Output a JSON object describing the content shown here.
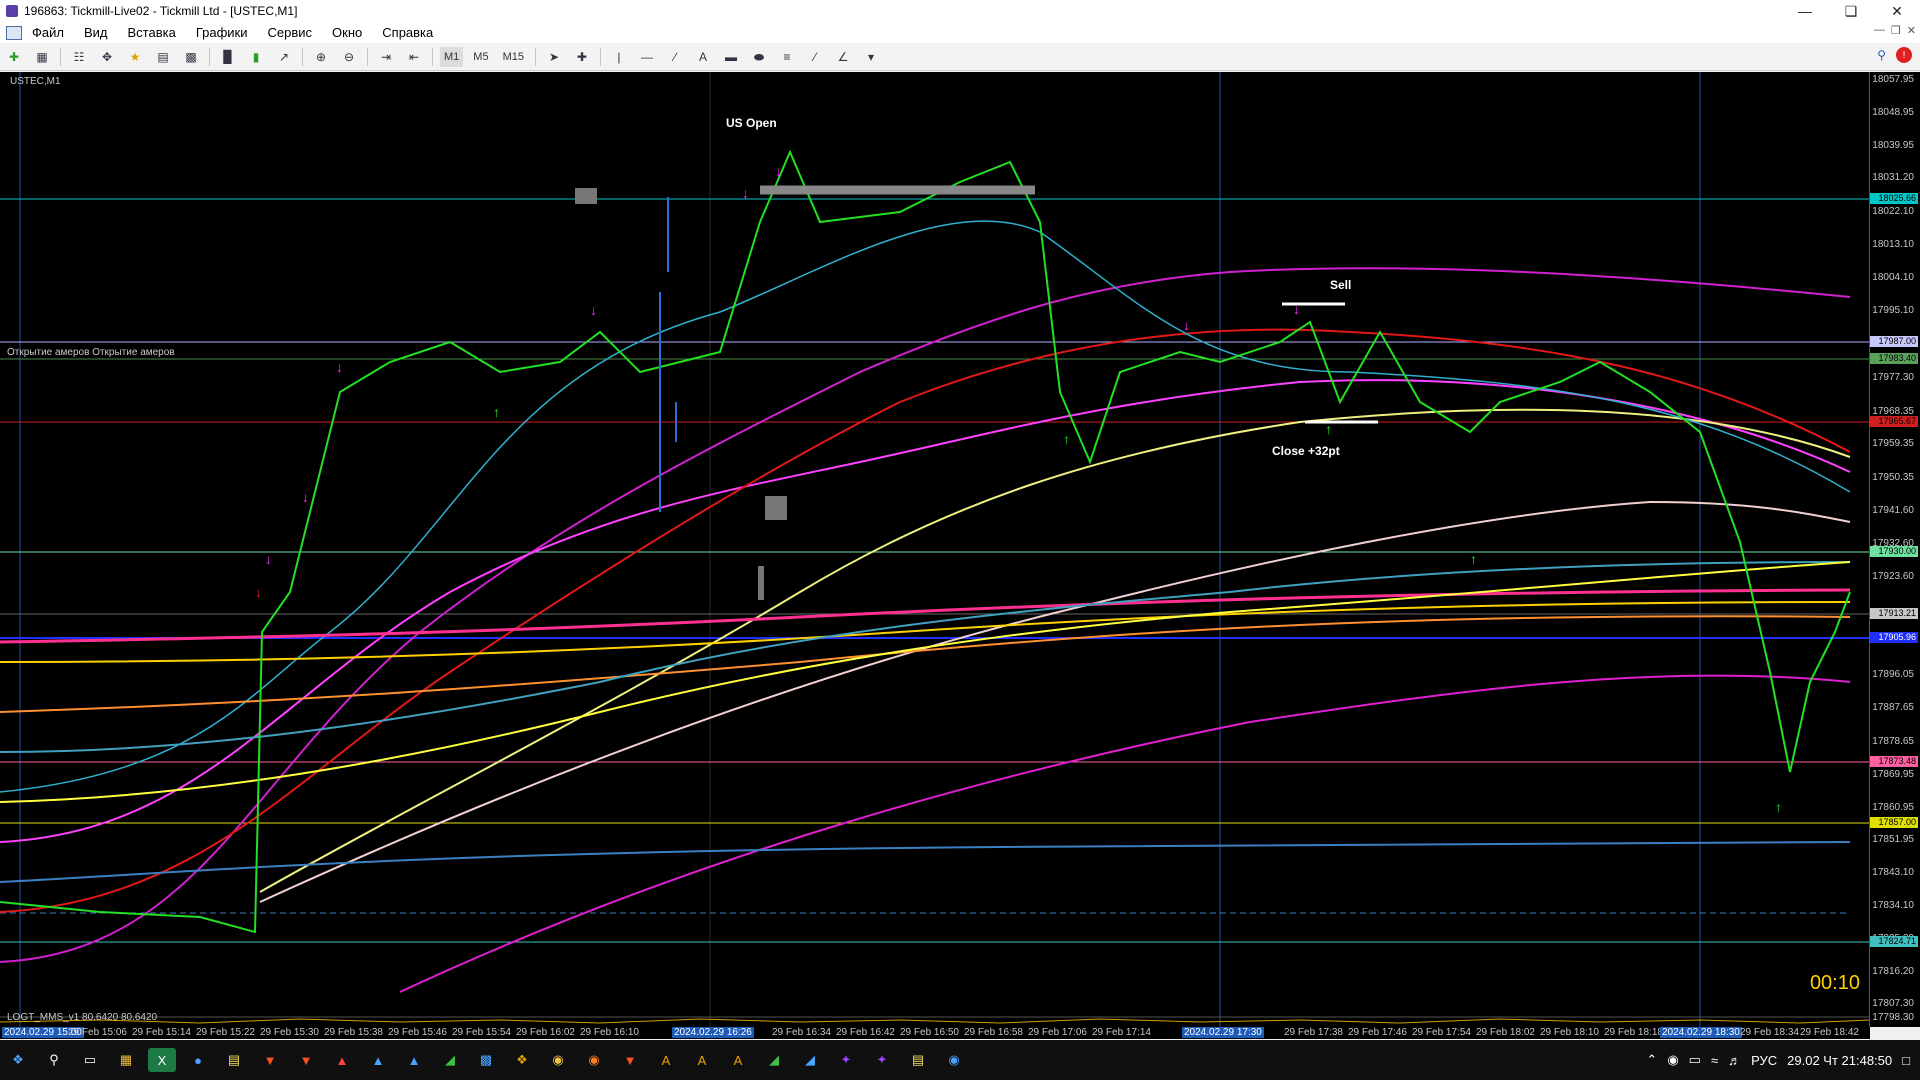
{
  "window": {
    "title": "196863: Tickmill-Live02 - Tickmill Ltd - [USTEC,M1]"
  },
  "menu": [
    "Файл",
    "Вид",
    "Вставка",
    "Графики",
    "Сервис",
    "Окно",
    "Справка"
  ],
  "toolbar": {
    "timeframes": [
      "M1",
      "M5",
      "M15"
    ]
  },
  "chart": {
    "symbol": "USTEC,M1",
    "timer": "00:10",
    "indicator_label": "LOGT_MMS_v1 80.6420 80.6420",
    "open_labels": "Открытие амеров   Открытие амеров",
    "annotations": {
      "us_open": "US Open",
      "sell": "Sell",
      "close": "Close +32pt"
    },
    "price_ticks": [
      "18057.95",
      "18048.95",
      "18039.95",
      "18031.20",
      "18022.10",
      "18013.10",
      "18004.10",
      "17995.10",
      "17977.30",
      "17968.35",
      "17959.35",
      "17950.35",
      "17941.60",
      "17932.60",
      "17923.60",
      "17896.05",
      "17887.65",
      "17878.65",
      "17869.95",
      "17860.95",
      "17851.95",
      "17843.10",
      "17834.10",
      "17825.20",
      "17816.20",
      "17807.30",
      "17798.30"
    ],
    "price_tags": {
      "t1": {
        "text": "18025.66",
        "color": "#00c8c8"
      },
      "t2": {
        "text": "17987.00",
        "color": "#c8c8ff"
      },
      "t3": {
        "text": "17983.40",
        "color": "#5aa05a"
      },
      "t4": {
        "text": "17965.67",
        "color": "#d02020"
      },
      "t5": {
        "text": "17930.00",
        "color": "#6ee0a0"
      },
      "t6": {
        "text": "17913.21",
        "color": "#c8c8c8"
      },
      "t7": {
        "text": "17905.96",
        "color": "#2030ff"
      },
      "t8": {
        "text": "17873.48",
        "color": "#ff60a0"
      },
      "t9": {
        "text": "17857.00",
        "color": "#e0e000"
      },
      "t10": {
        "text": "17824.71",
        "color": "#40c0c0"
      }
    },
    "time_ticks": [
      "2024.02.29 15:00",
      "29 Feb 15:06",
      "29 Feb 15:14",
      "29 Feb 15:22",
      "29 Feb 15:30",
      "29 Feb 15:38",
      "29 Feb 15:46",
      "29 Feb 15:54",
      "29 Feb 16:02",
      "29 Feb 16:10",
      "2024.02.29 16:26",
      "29 Feb 16:34",
      "29 Feb 16:42",
      "29 Feb 16:50",
      "29 Feb 16:58",
      "29 Feb 17:06",
      "29 Feb 17:14",
      "2024.02.29 17:30",
      "29 Feb 17:38",
      "29 Feb 17:46",
      "29 Feb 17:54",
      "29 Feb 18:02",
      "29 Feb 18:10",
      "29 Feb 18:18",
      "2024.02.29 18:30",
      "29 Feb 18:34",
      "29 Feb 18:42"
    ]
  },
  "tray": {
    "lang": "РУС",
    "datetime": "29.02 Чт 21:48:50"
  }
}
